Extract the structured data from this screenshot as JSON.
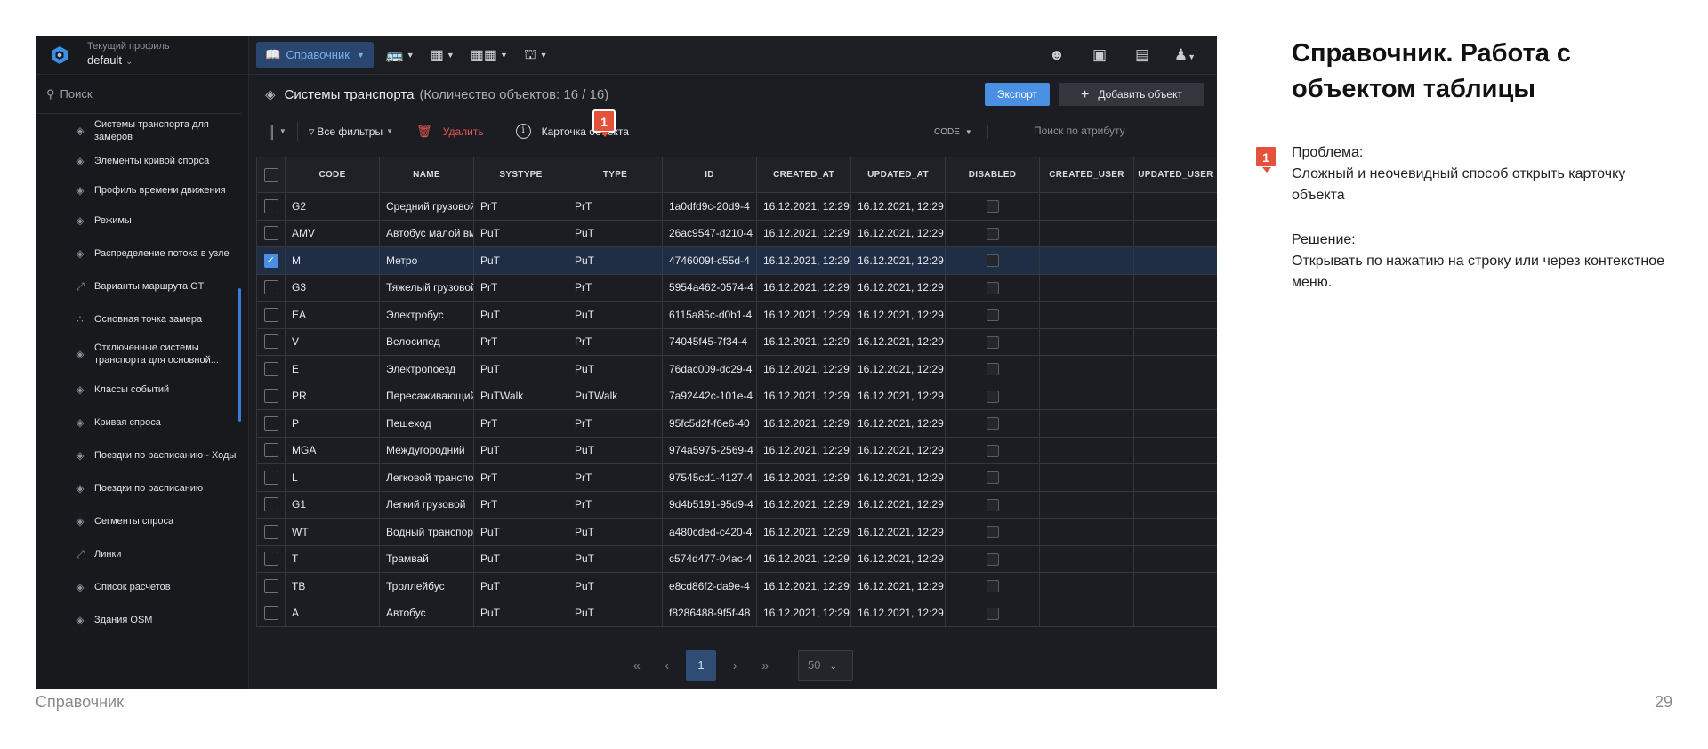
{
  "app": {
    "profile_label": "Текущий профиль",
    "profile_value": "default",
    "search_placeholder": "Поиск",
    "sidebar_items": [
      "Системы транспорта для замеров",
      "Элементы кривой спорса",
      "Профиль времени движения",
      "Режимы",
      "Распределение потока в узле",
      "Варианты маршрута ОТ",
      "Основная точка замера",
      "Отключенные системы транспорта для основной...",
      "Классы событий",
      "Кривая спроса",
      "Поездки по расписанию - Ходы",
      "Поездки по расписанию",
      "Сегменты спроса",
      "Линки",
      "Список расчетов",
      "Здания OSM"
    ],
    "toolbar_primary": "Справочник",
    "header_title": "Системы транспорта",
    "header_count": "(Количество объектов: 16 / 16)",
    "export_label": "Экспорт",
    "add_label": "Добавить объект",
    "filters_label": "Все фильтры",
    "delete_label": "Удалить",
    "card_label": "Карточка объекта",
    "attr_select": "CODE",
    "attr_search_placeholder": "Поиск по атрибуту",
    "columns": [
      "CODE",
      "NAME",
      "SYSTYPE",
      "TYPE",
      "ID",
      "CREATED_AT",
      "UPDATED_AT",
      "DISABLED",
      "CREATED_USER",
      "UPDATED_USER"
    ],
    "rows": [
      {
        "code": "G2",
        "name": "Средний грузовой",
        "systype": "PrT",
        "type": "PrT",
        "id": "1a0dfd9c-20d9-4",
        "created_at": "16.12.2021, 12:29",
        "updated_at": "16.12.2021, 12:29",
        "selected": false
      },
      {
        "code": "AMV",
        "name": "Автобус малой вм",
        "systype": "PuT",
        "type": "PuT",
        "id": "26ac9547-d210-4",
        "created_at": "16.12.2021, 12:29",
        "updated_at": "16.12.2021, 12:29",
        "selected": false
      },
      {
        "code": "M",
        "name": "Метро",
        "systype": "PuT",
        "type": "PuT",
        "id": "4746009f-c55d-4",
        "created_at": "16.12.2021, 12:29",
        "updated_at": "16.12.2021, 12:29",
        "selected": true
      },
      {
        "code": "G3",
        "name": "Тяжелый грузовой",
        "systype": "PrT",
        "type": "PrT",
        "id": "5954a462-0574-4",
        "created_at": "16.12.2021, 12:29",
        "updated_at": "16.12.2021, 12:29",
        "selected": false
      },
      {
        "code": "EA",
        "name": "Электробус",
        "systype": "PuT",
        "type": "PuT",
        "id": "6115a85c-d0b1-4",
        "created_at": "16.12.2021, 12:29",
        "updated_at": "16.12.2021, 12:29",
        "selected": false
      },
      {
        "code": "V",
        "name": "Велосипед",
        "systype": "PrT",
        "type": "PrT",
        "id": "74045f45-7f34-4",
        "created_at": "16.12.2021, 12:29",
        "updated_at": "16.12.2021, 12:29",
        "selected": false
      },
      {
        "code": "E",
        "name": "Электропоезд",
        "systype": "PuT",
        "type": "PuT",
        "id": "76dac009-dc29-4",
        "created_at": "16.12.2021, 12:29",
        "updated_at": "16.12.2021, 12:29",
        "selected": false
      },
      {
        "code": "PR",
        "name": "Пересаживающийся",
        "systype": "PuTWalk",
        "type": "PuTWalk",
        "id": "7a92442c-101e-4",
        "created_at": "16.12.2021, 12:29",
        "updated_at": "16.12.2021, 12:29",
        "selected": false
      },
      {
        "code": "P",
        "name": "Пешеход",
        "systype": "PrT",
        "type": "PrT",
        "id": "95fc5d2f-f6e6-40",
        "created_at": "16.12.2021, 12:29",
        "updated_at": "16.12.2021, 12:29",
        "selected": false
      },
      {
        "code": "MGA",
        "name": "Междугородний",
        "systype": "PuT",
        "type": "PuT",
        "id": "974a5975-2569-4",
        "created_at": "16.12.2021, 12:29",
        "updated_at": "16.12.2021, 12:29",
        "selected": false
      },
      {
        "code": "L",
        "name": "Легковой транспорт",
        "systype": "PrT",
        "type": "PrT",
        "id": "97545cd1-4127-4",
        "created_at": "16.12.2021, 12:29",
        "updated_at": "16.12.2021, 12:29",
        "selected": false
      },
      {
        "code": "G1",
        "name": "Легкий грузовой",
        "systype": "PrT",
        "type": "PrT",
        "id": "9d4b5191-95d9-4",
        "created_at": "16.12.2021, 12:29",
        "updated_at": "16.12.2021, 12:29",
        "selected": false
      },
      {
        "code": "WT",
        "name": "Водный транспорт",
        "systype": "PuT",
        "type": "PuT",
        "id": "a480cded-c420-4",
        "created_at": "16.12.2021, 12:29",
        "updated_at": "16.12.2021, 12:29",
        "selected": false
      },
      {
        "code": "T",
        "name": "Трамвай",
        "systype": "PuT",
        "type": "PuT",
        "id": "c574d477-04ac-4",
        "created_at": "16.12.2021, 12:29",
        "updated_at": "16.12.2021, 12:29",
        "selected": false
      },
      {
        "code": "TB",
        "name": "Троллейбус",
        "systype": "PuT",
        "type": "PuT",
        "id": "e8cd86f2-da9e-4",
        "created_at": "16.12.2021, 12:29",
        "updated_at": "16.12.2021, 12:29",
        "selected": false
      },
      {
        "code": "A",
        "name": "Автобус",
        "systype": "PuT",
        "type": "PuT",
        "id": "f8286488-9f5f-48",
        "created_at": "16.12.2021, 12:29",
        "updated_at": "16.12.2021, 12:29",
        "selected": false
      }
    ],
    "pagination": {
      "current_page": "1",
      "page_size": "50"
    }
  },
  "badge_number": "1",
  "slide": {
    "title": "Справочник. Работа с объектом таблицы",
    "problem_label": "Проблема:",
    "problem_text": "Сложный и неочевидный способ открыть карточку объекта",
    "solution_label": "Решение:",
    "solution_text": "Открывать по нажатию на строку или через контекстное меню.",
    "footer_left": "Справочник",
    "page_number": "29"
  },
  "colors": {
    "accent": "#4a90e2",
    "badge": "#e5523b",
    "delete": "#e0574f",
    "app_bg": "#1b1d22"
  }
}
